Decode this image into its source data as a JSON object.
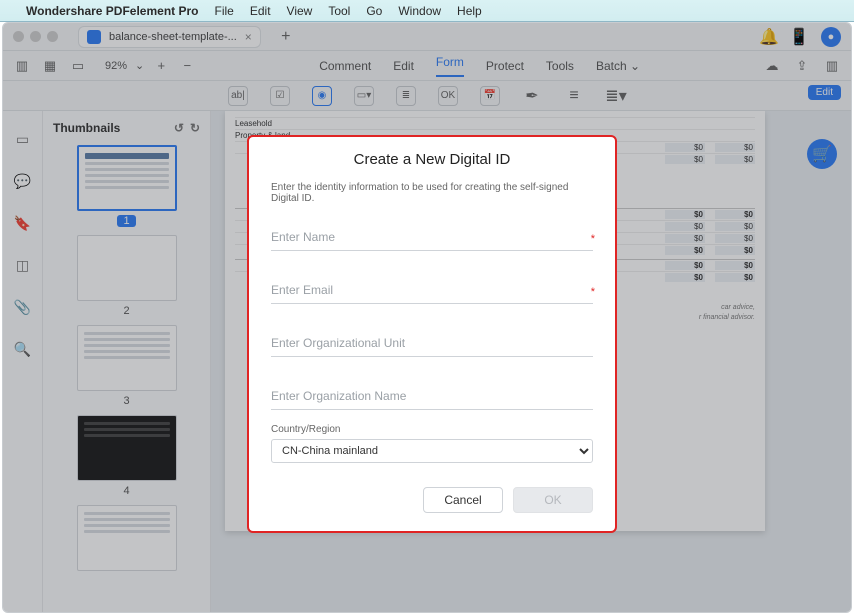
{
  "menubar": {
    "apple": "",
    "appname": "Wondershare PDFelement Pro",
    "items": [
      "File",
      "Edit",
      "View",
      "Tool",
      "Go",
      "Window",
      "Help"
    ]
  },
  "titlebar": {
    "tab_title": "balance-sheet-template-...",
    "tab_close": "×",
    "newtab": "+",
    "bell": "🔔",
    "phone": "📱",
    "avatar": "●"
  },
  "toolbar1": {
    "zoom": "92%",
    "zoom_caret": "⌄",
    "plus": "+",
    "minus": "−",
    "tabs": {
      "comment": "Comment",
      "edit": "Edit",
      "form": "Form",
      "protect": "Protect",
      "tools": "Tools",
      "batch": "Batch",
      "batch_caret": "⌄"
    },
    "cloud": "☁",
    "share": "⇪",
    "panel": "▥"
  },
  "toolbar2": {
    "edit_pill": "Edit",
    "icons": {
      "textfield": "ab|",
      "checkbox": "☑",
      "radio": "◉",
      "combo": "▭▾",
      "list": "≣",
      "button": "OK",
      "date": "📅",
      "sign": "✒",
      "align": "≡",
      "more": "≣▾"
    }
  },
  "rail": {
    "page": "▭",
    "comment": "💬",
    "bookmark": "🔖",
    "layers": "◫",
    "attach": "📎",
    "search": "🔍"
  },
  "thumbs": {
    "title": "Thumbnails",
    "rotate_l": "↺",
    "rotate_r": "↻",
    "pages": [
      "1",
      "2",
      "3",
      "4"
    ]
  },
  "doc": {
    "rows": [
      {
        "k": "Leasehold",
        "a": "",
        "b": ""
      },
      {
        "k": "Property & land",
        "a": "",
        "b": ""
      },
      {
        "k": "",
        "a": "$0",
        "b": "$0"
      },
      {
        "k": "",
        "a": "$0",
        "b": "$0"
      },
      {
        "k": "",
        "a": "$0",
        "b": "$0"
      },
      {
        "k": "",
        "a": "$0",
        "b": "$0"
      },
      {
        "k": "",
        "a": "$0",
        "b": "$0"
      },
      {
        "k": "",
        "a": "$0",
        "b": "$0"
      },
      {
        "k": "",
        "a": "$0",
        "b": "$0"
      },
      {
        "k": "",
        "a": "$0",
        "b": "$0"
      }
    ],
    "note1": "car advice,",
    "note2": "r financial advisor."
  },
  "fab": "🛒",
  "modal": {
    "title": "Create a New Digital ID",
    "hint": "Enter the identity information to be used for creating the self-signed Digital ID.",
    "name_ph": "Enter Name",
    "email_ph": "Enter Email",
    "ou_ph": "Enter Organizational Unit",
    "org_ph": "Enter Organization Name",
    "country_label": "Country/Region",
    "country_value": "CN-China mainland",
    "req": "*",
    "cancel": "Cancel",
    "ok": "OK"
  }
}
